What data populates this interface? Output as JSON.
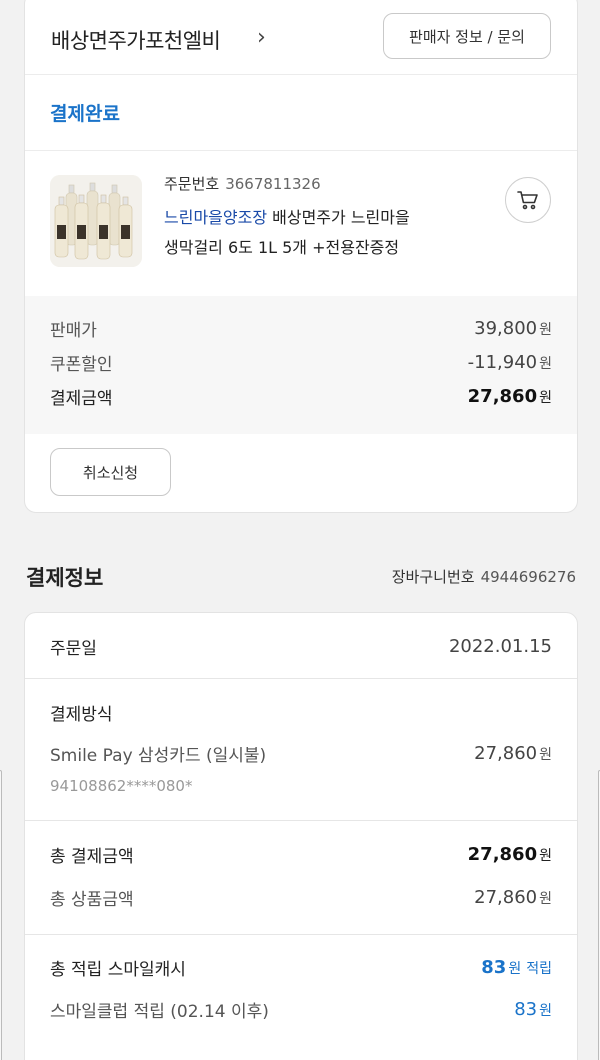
{
  "shop": {
    "name": "배상면주가포천엘비",
    "chevron": "›",
    "seller_button": "판매자 정보 / 문의"
  },
  "order": {
    "status": "결제완료",
    "order_no_label": "주문번호",
    "order_no": "3667811326",
    "brand": "느린마을양조장",
    "title_rest_line1": "배상면주가 느린마을",
    "title_line2": "생막걸리 6도 1L 5개 +전용잔증정",
    "cart_icon": "cart-icon"
  },
  "prices": {
    "sale_label": "판매가",
    "sale_value": "39,800",
    "coupon_label": "쿠폰할인",
    "coupon_value": "-11,940",
    "total_label": "결제금액",
    "total_value": "27,860",
    "won": "원"
  },
  "cancel_button": "취소신청",
  "payment": {
    "title": "결제정보",
    "cart_no_label": "장바구니번호",
    "cart_no": "4944696276",
    "order_date_label": "주문일",
    "order_date": "2022.01.15",
    "method_label": "결제방식",
    "method": "Smile Pay 삼성카드 (일시불)",
    "method_amount": "27,860",
    "card_number": "94108862****080*",
    "total_pay_label": "총 결제금액",
    "total_pay": "27,860",
    "total_goods_label": "총 상품금액",
    "total_goods": "27,860",
    "smilecash_label": "총 적립 스마일캐시",
    "smilecash_value": "83",
    "smilecash_suffix": "적립",
    "smileclub_label": "스마일클럽 적립 (02.14 이후)",
    "smileclub_value": "83",
    "won": "원"
  },
  "colors": {
    "accent_blue": "#1a73c9",
    "brand_link": "#1a4aa8",
    "background": "#f2f2f2"
  }
}
